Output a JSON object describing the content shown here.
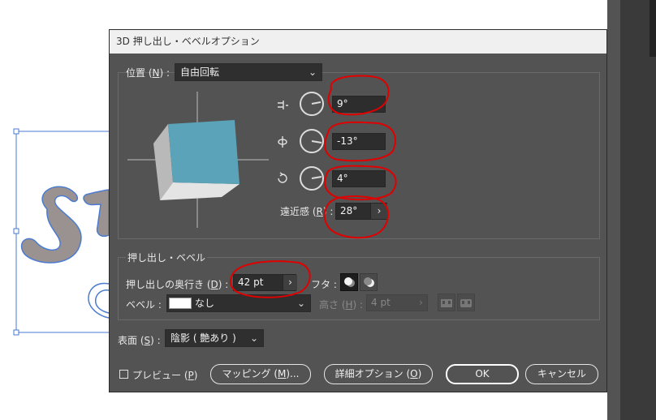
{
  "colors": {
    "dialog_bg": "#535353",
    "cube_front": "#5ba3b8",
    "annotation": "#e00000",
    "selection": "#4a7bd1",
    "letter_fill": "#9a9290"
  },
  "dialog": {
    "title": "3D 押し出し・ベベルオプション",
    "position": {
      "label": "位置 (",
      "label_key": "N",
      "label_end": ") :",
      "value": "自由回転"
    },
    "rotation": {
      "x_icon": "rotate-x-icon",
      "x_value": "9°",
      "y_icon": "rotate-y-icon",
      "y_value": "-13°",
      "z_icon": "rotate-z-icon",
      "z_value": "4°",
      "perspective_label": "遠近感 (",
      "perspective_key": "R",
      "perspective_end": ") :",
      "perspective_value": "28°",
      "perspective_arrow": "›"
    },
    "extrude": {
      "group_label": "押し出し・ベベル",
      "depth_label": "押し出しの奥行き (",
      "depth_key": "D",
      "depth_end": ") :",
      "depth_value": "42 pt",
      "depth_arrow": "›",
      "cap_label": "フタ :",
      "bevel_label": "ベベル :",
      "bevel_value": "なし",
      "height_label": "高さ (",
      "height_key": "H",
      "height_end": ") :",
      "height_value": "4 pt",
      "height_arrow": "›"
    },
    "surface": {
      "label": "表面 (",
      "label_key": "S",
      "label_end": ") :",
      "value": "陰影 ( 艶あり )"
    },
    "footer": {
      "preview_label": "プレビュー (",
      "preview_key": "P",
      "preview_end": ")",
      "mapping_label": "マッピング (",
      "mapping_key": "M",
      "mapping_end": ")...",
      "more_options_label": "詳細オプション (",
      "more_options_key": "O",
      "more_options_end": ")",
      "ok_label": "OK",
      "cancel_label": "キャンセル"
    }
  }
}
